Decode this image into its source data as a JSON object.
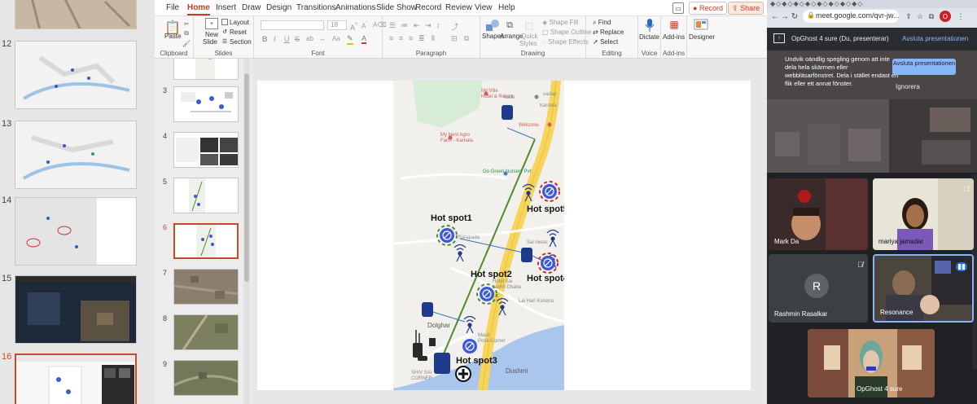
{
  "left_panel": {
    "slide_numbers": [
      "12",
      "13",
      "14",
      "15",
      "16"
    ]
  },
  "ribbon": {
    "tabs": [
      "File",
      "Home",
      "Insert",
      "Draw",
      "Design",
      "Transitions",
      "Animations",
      "Slide Show",
      "Record",
      "Review",
      "View",
      "Help"
    ],
    "active_tab": "Home",
    "record_label": "Record",
    "share_label": "Share",
    "clipboard": {
      "paste": "Paste",
      "label": "Clipboard"
    },
    "slides": {
      "new_slide_1": "New",
      "new_slide_2": "Slide",
      "layout": "Layout",
      "reset": "Reset",
      "section": "Section",
      "label": "Slides"
    },
    "font": {
      "label": "Font",
      "bold": "B",
      "italic": "I",
      "underline": "U",
      "strike": "S",
      "size": "18"
    },
    "paragraph": {
      "label": "Paragraph"
    },
    "drawing": {
      "shapes": "Shapes",
      "arrange": "Arrange",
      "quick_1": "Quick",
      "quick_2": "Styles",
      "fill": "Shape Fill",
      "outline": "Shape Outline",
      "effects": "Shape Effects",
      "label": "Drawing"
    },
    "editing": {
      "find": "Find",
      "replace": "Replace",
      "select": "Select",
      "label": "Editing"
    },
    "voice": {
      "dictate": "Dictate",
      "label": "Voice"
    },
    "addins": {
      "addins": "Add-ins",
      "label": "Add-ins"
    },
    "designer": {
      "designer": "Designer"
    }
  },
  "thumbnails": {
    "numbers": [
      "3",
      "4",
      "5",
      "6",
      "7",
      "8",
      "9"
    ],
    "selected": "6"
  },
  "map": {
    "hotspots": [
      "Hot spot1",
      "Hot spot2",
      "Hot spot3",
      "Hot spot4",
      "Hot spot5"
    ],
    "places": {
      "mo_ville": "Mo'Ville",
      "mo_ville_sub": "Hotel & Resort",
      "kalle": "Kalle",
      "vadap": "vadap",
      "karnala": "Karnala",
      "welcome": "Welcome",
      "agro": "My Nest Agro",
      "agro_sub": "Farm - Karnala",
      "nursery": "Go Green Nursery Pvt",
      "barapada": "Barapada",
      "sai_niwas": "Sai niwas",
      "hotel_sai": "Hotel Sai",
      "dhaba": "Aamh Dhaba",
      "lai_hari": "Lai Hari Kshetra",
      "dolghar": "Dolghar",
      "mauli": "Mauli",
      "corner": "Pose Corner",
      "dushmi": "Dushmi",
      "shiv_sai": "SHIV SAI",
      "shiv_corner": "CORNER"
    }
  },
  "meet": {
    "url": "meet.google.com/qvr-jw...",
    "avatar_letter": "O",
    "presenter_label": "OpGhost 4 sure (Du, presenterar)",
    "stop_link": "Avsluta presentationen",
    "warning_text": "Undvik oändlig spegling genom att inte dela hela skärmen eller webbläsarfönstret. Dela i stället endast en flik eller ett annat fönster.",
    "stop_button": "Avsluta presentationen",
    "ignore_button": "Ignorera",
    "participants": [
      {
        "name": "Mark Da"
      },
      {
        "name": "mariya jamadar"
      },
      {
        "name": "Rashmin Rasalkar",
        "initial": "R"
      },
      {
        "name": "Resonance"
      },
      {
        "name": "OpGhost 4 sure"
      }
    ]
  },
  "colors": {
    "accent": "#c43e1c",
    "hotspot_blue": "#3d5bd9",
    "hotspot_red_ring": "#cf2a2a",
    "hotspot_green_ring": "#4a8a3a",
    "route_green": "#4f8b2e",
    "road_yellow": "#f7d55a",
    "tower_blue": "#1f3a8a",
    "meet_bg": "#202124",
    "meet_link": "#8ab4f8"
  }
}
